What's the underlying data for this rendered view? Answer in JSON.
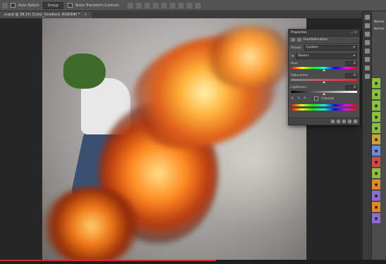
{
  "options_bar": {
    "auto_select_label": "Auto-Select:",
    "auto_select_value": "Group",
    "show_transform_label": "Show Transform Controls"
  },
  "document_tab": {
    "title": "e-psd @ 38.1% (Color_Gradient, RGB/8#) *",
    "close": "×"
  },
  "properties": {
    "title": "Properties",
    "subtitle": "Hue/Saturation",
    "preset_label": "Preset:",
    "preset_value": "Custom",
    "channel_value": "Master",
    "hue_label": "Hue:",
    "hue_value": "0",
    "saturation_label": "Saturation:",
    "saturation_value": "0",
    "lightness_label": "Lightness:",
    "lightness_value": "0",
    "colorize_label": "Colorize"
  },
  "right_panel": {
    "mode_value": "Normal",
    "mode_label": "Normal"
  },
  "layer_swatches": [
    {
      "color": "#8cbf3f",
      "icon": "eye-icon"
    },
    {
      "color": "#8cbf3f",
      "icon": "eye-icon"
    },
    {
      "color": "#8cbf3f",
      "icon": "eye-icon"
    },
    {
      "color": "#8cbf3f",
      "icon": "eye-icon"
    },
    {
      "color": "#8cbf3f",
      "icon": "eye-icon"
    },
    {
      "color": "#c9a23a",
      "icon": "eye-icon"
    },
    {
      "color": "#6f8ad8",
      "icon": "eye-icon"
    },
    {
      "color": "#d04a4a",
      "icon": "eye-icon"
    },
    {
      "color": "#8cbf3f",
      "icon": "eye-icon"
    },
    {
      "color": "#e08a2a",
      "icon": "eye-icon"
    },
    {
      "color": "#8b6dd0",
      "icon": "eye-icon"
    },
    {
      "color": "#e08a2a",
      "icon": "eye-icon"
    },
    {
      "color": "#8b6dd0",
      "icon": "eye-icon"
    }
  ],
  "playback_progress": 0.56
}
